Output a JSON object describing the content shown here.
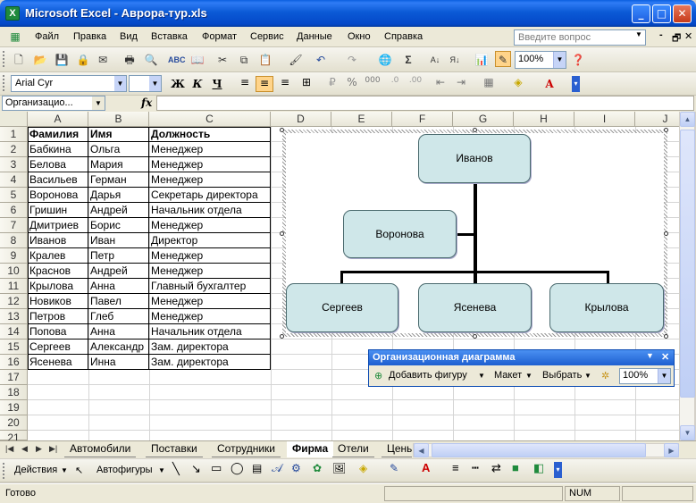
{
  "window": {
    "title": "Microsoft Excel - Аврора-тур.xls",
    "app_icon": "X",
    "minimize_glyph": "_",
    "maximize_glyph": "□",
    "close_glyph": "✕"
  },
  "menu": {
    "items": [
      "Файл",
      "Правка",
      "Вид",
      "Вставка",
      "Формат",
      "Сервис",
      "Данные",
      "Окно",
      "Справка"
    ],
    "help_placeholder": "Введите вопрос",
    "doc_controls": [
      "-",
      "🗗",
      "✕"
    ]
  },
  "toolbar_standard": {
    "zoom": "100%"
  },
  "toolbar_format": {
    "font_name": "Arial Cyr",
    "font_size": "",
    "bold": "Ж",
    "italic": "К",
    "underline": "Ч",
    "percent": "%",
    "thousands": "000"
  },
  "formula_bar": {
    "name_box": "Организацио...",
    "fx": "fx",
    "formula": ""
  },
  "columns": [
    "A",
    "B",
    "C",
    "D",
    "E",
    "F",
    "G",
    "H",
    "I",
    "J"
  ],
  "rows": [
    "1",
    "2",
    "3",
    "4",
    "5",
    "6",
    "7",
    "8",
    "9",
    "10",
    "11",
    "12",
    "13",
    "14",
    "15",
    "16",
    "17",
    "18",
    "19",
    "20",
    "21"
  ],
  "table": {
    "headers": [
      "Фамилия",
      "Имя",
      "Должность"
    ],
    "rows": [
      [
        "Бабкина",
        "Ольга",
        "Менеджер"
      ],
      [
        "Белова",
        "Мария",
        "Менеджер"
      ],
      [
        "Васильев",
        "Герман",
        "Менеджер"
      ],
      [
        "Воронова",
        "Дарья",
        "Секретарь директора"
      ],
      [
        "Гришин",
        "Андрей",
        "Начальник отдела"
      ],
      [
        "Дмитриев",
        "Борис",
        "Менеджер"
      ],
      [
        "Иванов",
        "Иван",
        "Директор"
      ],
      [
        "Кралев",
        "Петр",
        "Менеджер"
      ],
      [
        "Краснов",
        "Андрей",
        "Менеджер"
      ],
      [
        "Крылова",
        "Анна",
        "Главный бухгалтер"
      ],
      [
        "Новиков",
        "Павел",
        "Менеджер"
      ],
      [
        "Петров",
        "Глеб",
        "Менеджер"
      ],
      [
        "Попова",
        "Анна",
        "Начальник отдела"
      ],
      [
        "Сергеев",
        "Александр",
        "Зам. директора"
      ],
      [
        "Ясенева",
        "Инна",
        "Зам. директора"
      ]
    ]
  },
  "org_chart": {
    "top": "Иванов",
    "assistant": "Воронова",
    "subordinates": [
      "Сергеев",
      "Ясенева",
      "Крылова"
    ],
    "box_fill": "#cfe7e9"
  },
  "org_toolbar": {
    "title": "Организационная диаграмма",
    "add_shape": "Добавить фигуру",
    "layout": "Макет",
    "select": "Выбрать",
    "zoom": "100%"
  },
  "sheets": {
    "tabs": [
      "Автомобили",
      "Поставки",
      "Сотрудники",
      "Фирма",
      "Отели",
      "Цены"
    ],
    "active": "Фирма"
  },
  "draw_toolbar": {
    "actions": "Действия",
    "autoshapes": "Автофигуры"
  },
  "status": {
    "text": "Готово",
    "num": "NUM"
  }
}
